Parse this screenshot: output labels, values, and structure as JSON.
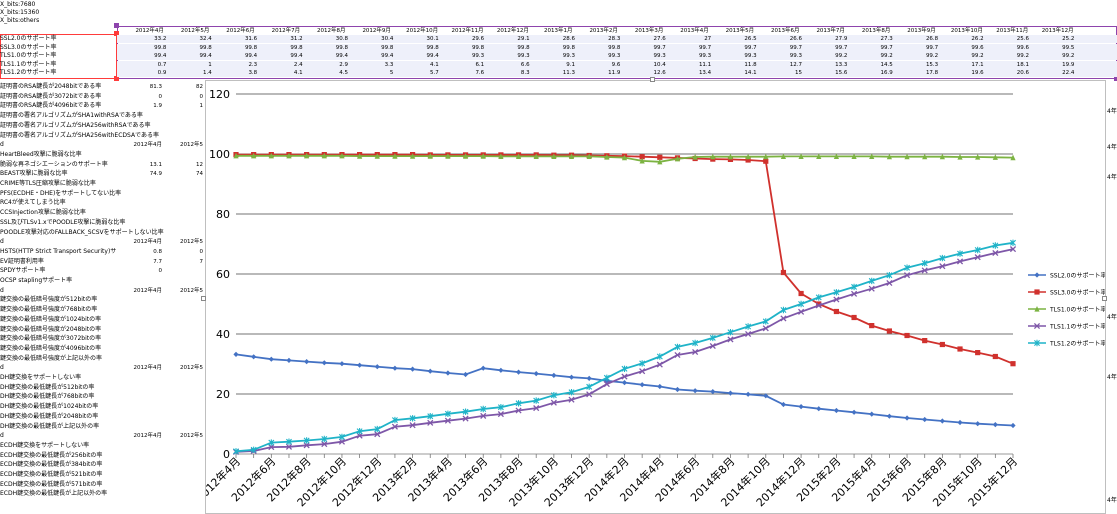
{
  "top_cells": [
    "X_bits:7680",
    "X_bits:15360",
    "X_bits:others"
  ],
  "columns": [
    "2012年4月",
    "2012年5月",
    "2012年6月",
    "2012年7月",
    "2012年8月",
    "2012年9月",
    "2012年10月",
    "2012年11月",
    "2012年12月",
    "2013年1月",
    "2013年2月",
    "2013年3月",
    "2013年4月",
    "2013年5月",
    "2013年6月",
    "2013年7月",
    "2013年8月",
    "2013年9月",
    "2013年10月",
    "2013年11月",
    "2013年12月"
  ],
  "table_rows": [
    {
      "label": "SSL2.0のサポート率",
      "values": [
        "33.2",
        "32.4",
        "31.6",
        "31.2",
        "30.8",
        "30.4",
        "30.1",
        "29.6",
        "29.1",
        "28.6",
        "28.3",
        "27.6",
        "27",
        "26.5",
        "26.6",
        "27.9",
        "27.3",
        "26.8",
        "26.2",
        "25.6",
        "25.2"
      ]
    },
    {
      "label": "SSL3.0のサポート率",
      "values": [
        "99.8",
        "99.8",
        "99.8",
        "99.8",
        "99.8",
        "99.8",
        "99.8",
        "99.8",
        "99.8",
        "99.8",
        "99.8",
        "99.7",
        "99.7",
        "99.7",
        "99.7",
        "99.7",
        "99.7",
        "99.7",
        "99.6",
        "99.6",
        "99.5"
      ]
    },
    {
      "label": "TLS1.0のサポート率",
      "values": [
        "99.4",
        "99.4",
        "99.4",
        "99.4",
        "99.4",
        "99.4",
        "99.4",
        "99.3",
        "99.3",
        "99.3",
        "99.3",
        "99.3",
        "99.3",
        "99.3",
        "99.3",
        "99.2",
        "99.2",
        "99.2",
        "99.2",
        "99.2",
        "99.2"
      ]
    },
    {
      "label": "TLS1.1のサポート率",
      "values": [
        "0.7",
        "1",
        "2.3",
        "2.4",
        "2.9",
        "3.3",
        "4.1",
        "6.1",
        "6.6",
        "9.1",
        "9.6",
        "10.4",
        "11.1",
        "11.8",
        "12.7",
        "13.3",
        "14.5",
        "15.3",
        "17.1",
        "18.1",
        "19.9"
      ]
    },
    {
      "label": "TLS1.2のサポート率",
      "values": [
        "0.9",
        "1.4",
        "3.8",
        "4.1",
        "4.5",
        "5",
        "5.7",
        "7.6",
        "8.3",
        "11.3",
        "11.9",
        "12.6",
        "13.4",
        "14.1",
        "15",
        "15.6",
        "16.9",
        "17.8",
        "19.6",
        "20.6",
        "22.4"
      ]
    }
  ],
  "side_rows": [
    {
      "label": "証明書のRSA鍵長が2048bitである率",
      "v1": "81.3",
      "v2": "82"
    },
    {
      "label": "証明書のRSA鍵長が3072bitである率",
      "v1": "0",
      "v2": "0"
    },
    {
      "label": "証明書のRSA鍵長が4096bitである率",
      "v1": "1.9",
      "v2": "1"
    },
    {
      "label": "証明書の署名アルゴリズムがSHA1withRSAである率",
      "v1": "",
      "v2": ""
    },
    {
      "label": "証明書の署名アルゴリズムがSHA256withRSAである率",
      "v1": "",
      "v2": ""
    },
    {
      "label": "証明書の署名アルゴリズムがSHA256withECDSAである率",
      "v1": "",
      "v2": ""
    },
    {
      "label": "d",
      "v1": "2012年4月",
      "v2": "2012年5"
    },
    {
      "label": "HeartBleed攻撃に脆弱な比率",
      "v1": "",
      "v2": ""
    },
    {
      "label": "脆弱な再ネゴシエーションのサポート率",
      "v1": "13.1",
      "v2": "12"
    },
    {
      "label": "BEAST攻撃に脆弱な比率",
      "v1": "74.9",
      "v2": "74"
    },
    {
      "label": "CRIME等TLS圧縮攻撃に脆弱な比率",
      "v1": "",
      "v2": ""
    },
    {
      "label": "PFS(ECDHE・DHE)をサポートしてない比率",
      "v1": "",
      "v2": ""
    },
    {
      "label": "RC4が使えてしまう比率",
      "v1": "",
      "v2": ""
    },
    {
      "label": "CCSInjection攻撃に脆弱な比率",
      "v1": "",
      "v2": ""
    },
    {
      "label": "SSL及びTLSv1.xでPOODLE攻撃に脆弱な比率",
      "v1": "",
      "v2": ""
    },
    {
      "label": "POODLE攻撃対応のFALLBACK_SCSVをサポートしない比率",
      "v1": "",
      "v2": ""
    },
    {
      "label": "d",
      "v1": "2012年4月",
      "v2": "2012年5"
    },
    {
      "label": "HSTS(HTTP Strict Transport Security)サ",
      "v1": "0.8",
      "v2": "0"
    },
    {
      "label": "EV証明書利用率",
      "v1": "7.7",
      "v2": "7"
    },
    {
      "label": "SPDYサポート率",
      "v1": "0",
      "v2": ""
    },
    {
      "label": "OCSP staplingサポート率",
      "v1": "",
      "v2": ""
    },
    {
      "label": "d",
      "v1": "2012年4月",
      "v2": "2012年5"
    },
    {
      "label": "鍵交換の最低暗号強度が512bitの率",
      "v1": "",
      "v2": ""
    },
    {
      "label": "鍵交換の最低暗号強度が768bitの率",
      "v1": "",
      "v2": ""
    },
    {
      "label": "鍵交換の最低暗号強度が1024bitの率",
      "v1": "",
      "v2": ""
    },
    {
      "label": "鍵交換の最低暗号強度が2048bitの率",
      "v1": "",
      "v2": ""
    },
    {
      "label": "鍵交換の最低暗号強度が3072bitの率",
      "v1": "",
      "v2": ""
    },
    {
      "label": "鍵交換の最低暗号強度が4096bitの率",
      "v1": "",
      "v2": ""
    },
    {
      "label": "鍵交換の最低暗号強度が上記以外の率",
      "v1": "",
      "v2": ""
    },
    {
      "label": "d",
      "v1": "2012年4月",
      "v2": "2012年5"
    },
    {
      "label": "DH鍵交換をサポートしない率",
      "v1": "",
      "v2": ""
    },
    {
      "label": "DH鍵交換の最低鍵長が512bitの率",
      "v1": "",
      "v2": ""
    },
    {
      "label": "DH鍵交換の最低鍵長が768bitの率",
      "v1": "",
      "v2": ""
    },
    {
      "label": "DH鍵交換の最低鍵長が1024bitの率",
      "v1": "",
      "v2": ""
    },
    {
      "label": "DH鍵交換の最低鍵長が2048bitの率",
      "v1": "",
      "v2": ""
    },
    {
      "label": "DH鍵交換の最低鍵長が上記以外の率",
      "v1": "",
      "v2": ""
    },
    {
      "label": "d",
      "v1": "2012年4月",
      "v2": "2012年5"
    },
    {
      "label": "ECDH鍵交換をサポートしない率",
      "v1": "",
      "v2": ""
    },
    {
      "label": "ECDH鍵交換の最低鍵長が256bitの率",
      "v1": "",
      "v2": ""
    },
    {
      "label": "ECDH鍵交換の最低鍵長が384bitの率",
      "v1": "",
      "v2": ""
    },
    {
      "label": "ECDH鍵交換の最低鍵長が521bitの率",
      "v1": "",
      "v2": ""
    },
    {
      "label": "ECDH鍵交換の最低鍵長が571bitの率",
      "v1": "",
      "v2": ""
    },
    {
      "label": "ECDH鍵交換の最低鍵長が上記以外の率",
      "v1": "",
      "v2": ""
    }
  ],
  "right_edge_labels": [
    "4年",
    "4年",
    "4年",
    "4年",
    "4年",
    "4年"
  ],
  "colors": {
    "ssl2": "#4472c4",
    "ssl3": "#d0312d",
    "tls10": "#7cb342",
    "tls11": "#7e57a8",
    "tls12": "#1fb3c8",
    "range_red": "#ff3b3b",
    "range_purple": "#8e44ad",
    "row_band": "#eef0fa"
  },
  "chart_data": {
    "type": "line",
    "ylim": [
      0,
      120
    ],
    "yticks": [
      0,
      20,
      40,
      60,
      80,
      100,
      120
    ],
    "x_tick_labels": [
      "2012年4月",
      "2012年6月",
      "2012年8月",
      "2012年10月",
      "2012年12月",
      "2013年2月",
      "2013年4月",
      "2013年6月",
      "2013年8月",
      "2013年10月",
      "2013年12月",
      "2014年2月",
      "2014年4月",
      "2014年6月",
      "2014年8月",
      "2014年10月",
      "2014年12月",
      "2015年2月",
      "2015年4月",
      "2015年6月",
      "2015年8月",
      "2015年10月",
      "2015年12月"
    ],
    "x": [
      "2012-04",
      "2012-05",
      "2012-06",
      "2012-07",
      "2012-08",
      "2012-09",
      "2012-10",
      "2012-11",
      "2012-12",
      "2013-01",
      "2013-02",
      "2013-03",
      "2013-04",
      "2013-05",
      "2013-06",
      "2013-07",
      "2013-08",
      "2013-09",
      "2013-10",
      "2013-11",
      "2013-12",
      "2014-01",
      "2014-02",
      "2014-03",
      "2014-04",
      "2014-05",
      "2014-06",
      "2014-07",
      "2014-08",
      "2014-09",
      "2014-10",
      "2014-11",
      "2014-12",
      "2015-01",
      "2015-02",
      "2015-03",
      "2015-04",
      "2015-05",
      "2015-06",
      "2015-07",
      "2015-08",
      "2015-09",
      "2015-10",
      "2015-11",
      "2015-12"
    ],
    "series": [
      {
        "name": "SSL2.0のサポート率",
        "color": "#4472c4",
        "marker": "diamond",
        "values": [
          33.2,
          32.4,
          31.6,
          31.2,
          30.8,
          30.4,
          30.1,
          29.6,
          29.1,
          28.6,
          28.3,
          27.6,
          27,
          26.5,
          28.6,
          27.9,
          27.3,
          26.8,
          26.2,
          25.6,
          25.2,
          24.4,
          23.8,
          23.1,
          22.5,
          21.5,
          21.1,
          20.8,
          20.3,
          19.9,
          19.4,
          16.5,
          15.8,
          15.1,
          14.5,
          13.9,
          13.3,
          12.6,
          12.0,
          11.5,
          11.0,
          10.5,
          10.1,
          9.8,
          9.5
        ]
      },
      {
        "name": "SSL3.0のサポート率",
        "color": "#d0312d",
        "marker": "square",
        "values": [
          99.8,
          99.8,
          99.8,
          99.8,
          99.8,
          99.8,
          99.8,
          99.8,
          99.8,
          99.8,
          99.8,
          99.7,
          99.7,
          99.7,
          99.7,
          99.7,
          99.7,
          99.7,
          99.6,
          99.6,
          99.5,
          99.4,
          99.3,
          99.1,
          98.9,
          98.7,
          98.5,
          98.3,
          98.2,
          98.0,
          97.6,
          60.5,
          53.5,
          50.0,
          47.5,
          45.5,
          42.8,
          41.0,
          39.5,
          37.8,
          36.5,
          35.0,
          33.8,
          32.5,
          30.1
        ]
      },
      {
        "name": "TLS1.0のサポート率",
        "color": "#7cb342",
        "marker": "triangle",
        "values": [
          99.4,
          99.4,
          99.4,
          99.4,
          99.4,
          99.4,
          99.4,
          99.3,
          99.3,
          99.3,
          99.3,
          99.3,
          99.3,
          99.3,
          99.3,
          99.2,
          99.2,
          99.2,
          99.2,
          99.2,
          99.2,
          99.0,
          98.8,
          97.7,
          97.4,
          98.4,
          99.0,
          99.1,
          99.1,
          99.1,
          99.1,
          99.2,
          99.2,
          99.2,
          99.2,
          99.2,
          99.2,
          99.1,
          99.1,
          99.1,
          99.1,
          99.0,
          99.0,
          98.9,
          98.8
        ]
      },
      {
        "name": "TLS1.1のサポート率",
        "color": "#7e57a8",
        "marker": "x",
        "values": [
          0.7,
          1,
          2.3,
          2.4,
          2.9,
          3.3,
          4.1,
          6.1,
          6.6,
          9.1,
          9.6,
          10.4,
          11.1,
          11.8,
          12.7,
          13.3,
          14.5,
          15.3,
          17.1,
          18.1,
          19.9,
          23.3,
          25.8,
          27.6,
          29.8,
          33.0,
          34.0,
          36.0,
          38.2,
          40.0,
          41.9,
          45.2,
          47.4,
          49.5,
          51.5,
          53.4,
          55.1,
          57.0,
          59.6,
          61.2,
          62.6,
          64.2,
          65.6,
          67.0,
          68.3
        ]
      },
      {
        "name": "TLS1.2のサポート率",
        "color": "#1fb3c8",
        "marker": "star",
        "values": [
          0.9,
          1.4,
          3.8,
          4.1,
          4.5,
          5,
          5.7,
          7.6,
          8.3,
          11.3,
          11.9,
          12.6,
          13.4,
          14.1,
          15,
          15.6,
          16.9,
          17.8,
          19.6,
          20.6,
          22.4,
          25.4,
          28.4,
          30.2,
          32.5,
          35.7,
          37.0,
          38.7,
          40.6,
          42.5,
          44.2,
          48.0,
          50.0,
          52.2,
          53.9,
          55.7,
          57.7,
          59.6,
          62.1,
          63.6,
          65.3,
          66.8,
          68.0,
          69.5,
          70.4
        ]
      }
    ]
  }
}
